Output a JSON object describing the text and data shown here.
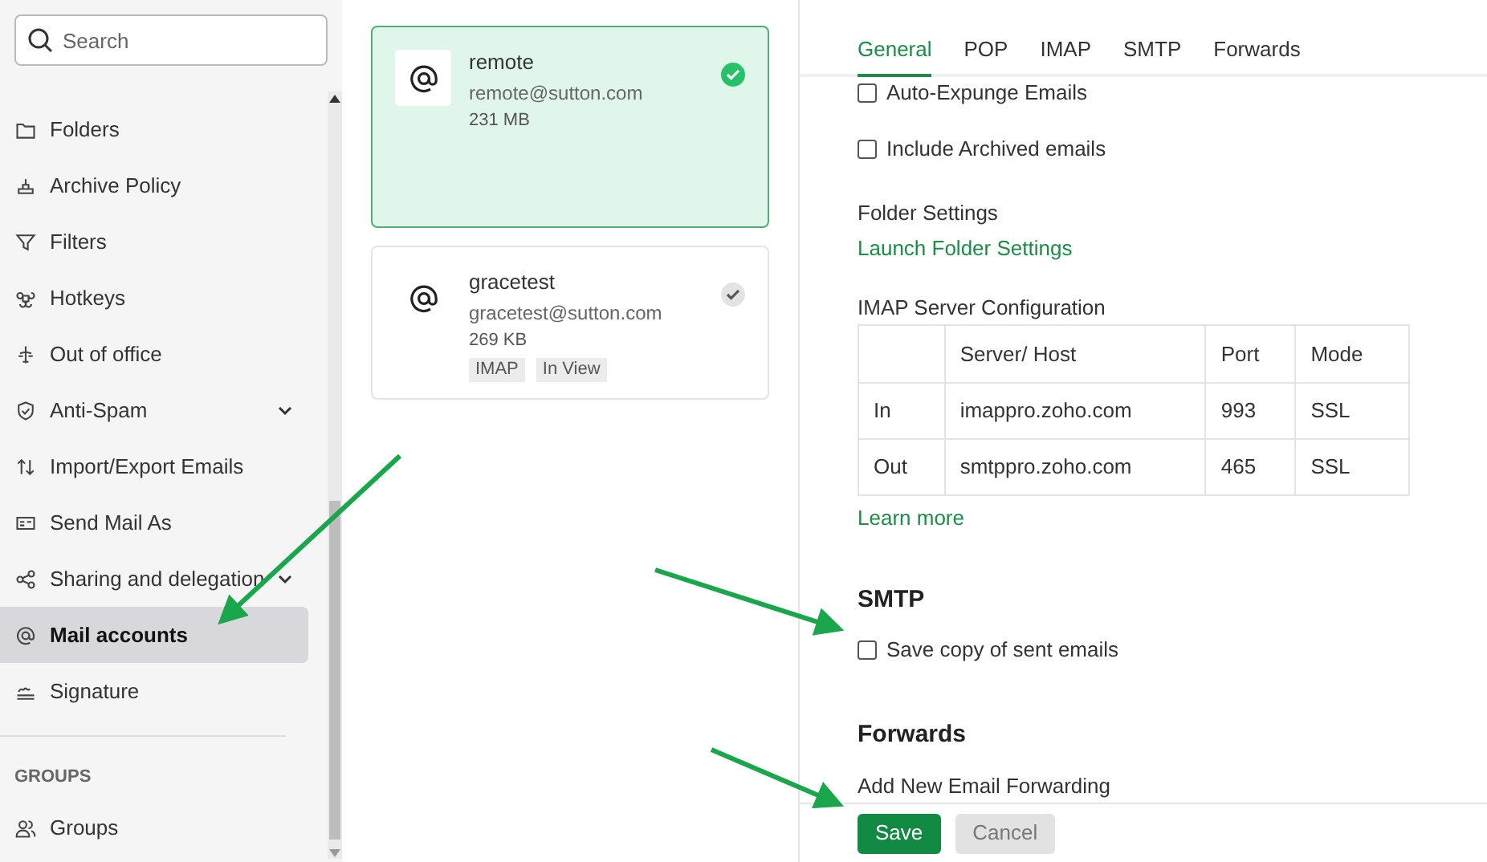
{
  "sidebar": {
    "search": {
      "placeholder": "Search"
    },
    "items": [
      {
        "label": "Folders",
        "selected": false,
        "has_submenu": false
      },
      {
        "label": "Archive Policy",
        "selected": false,
        "has_submenu": false
      },
      {
        "label": "Filters",
        "selected": false,
        "has_submenu": false
      },
      {
        "label": "Hotkeys",
        "selected": false,
        "has_submenu": false
      },
      {
        "label": "Out of office",
        "selected": false,
        "has_submenu": false
      },
      {
        "label": "Anti-Spam",
        "selected": false,
        "has_submenu": true
      },
      {
        "label": "Import/Export Emails",
        "selected": false,
        "has_submenu": false
      },
      {
        "label": "Send Mail As",
        "selected": false,
        "has_submenu": false
      },
      {
        "label": "Sharing and delegation",
        "selected": false,
        "has_submenu": true
      },
      {
        "label": "Mail accounts",
        "selected": true,
        "has_submenu": false
      },
      {
        "label": "Signature",
        "selected": false,
        "has_submenu": false
      }
    ],
    "section": {
      "title": "GROUPS",
      "items": [
        {
          "label": "Groups",
          "selected": false
        }
      ]
    }
  },
  "accounts": [
    {
      "name": "remote",
      "email": "remote@sutton.com",
      "size": "231 MB",
      "selected": true
    },
    {
      "name": "gracetest",
      "email": "gracetest@sutton.com",
      "size": "269 KB",
      "tags": [
        "IMAP",
        "In View"
      ],
      "selected": false
    }
  ],
  "tabs": [
    {
      "label": "General",
      "selected": true
    },
    {
      "label": "POP",
      "selected": false
    },
    {
      "label": "IMAP",
      "selected": false
    },
    {
      "label": "SMTP",
      "selected": false
    },
    {
      "label": "Forwards",
      "selected": false
    }
  ],
  "general": {
    "options": [
      {
        "label": "Auto-Expunge Emails",
        "checked": false
      },
      {
        "label": "Include Archived emails",
        "checked": false
      }
    ],
    "folder_settings": {
      "title": "Folder Settings",
      "link": "Launch Folder Settings"
    },
    "imap_config": {
      "title": "IMAP Server Configuration",
      "columns": [
        "",
        "Server/ Host",
        "Port",
        "Mode"
      ],
      "rows": [
        [
          "In",
          "imappro.zoho.com",
          "993",
          "SSL"
        ],
        [
          "Out",
          "smtppro.zoho.com",
          "465",
          "SSL"
        ]
      ],
      "link": "Learn more"
    }
  },
  "smtp": {
    "title": "SMTP",
    "options": [
      {
        "label": "Save copy of sent emails",
        "checked": false
      }
    ]
  },
  "forwards": {
    "title": "Forwards",
    "subtitle": "Add New Email Forwarding"
  },
  "buttons": [
    {
      "label": "Save",
      "kind": "primary"
    },
    {
      "label": "Cancel",
      "kind": "secondary"
    }
  ]
}
